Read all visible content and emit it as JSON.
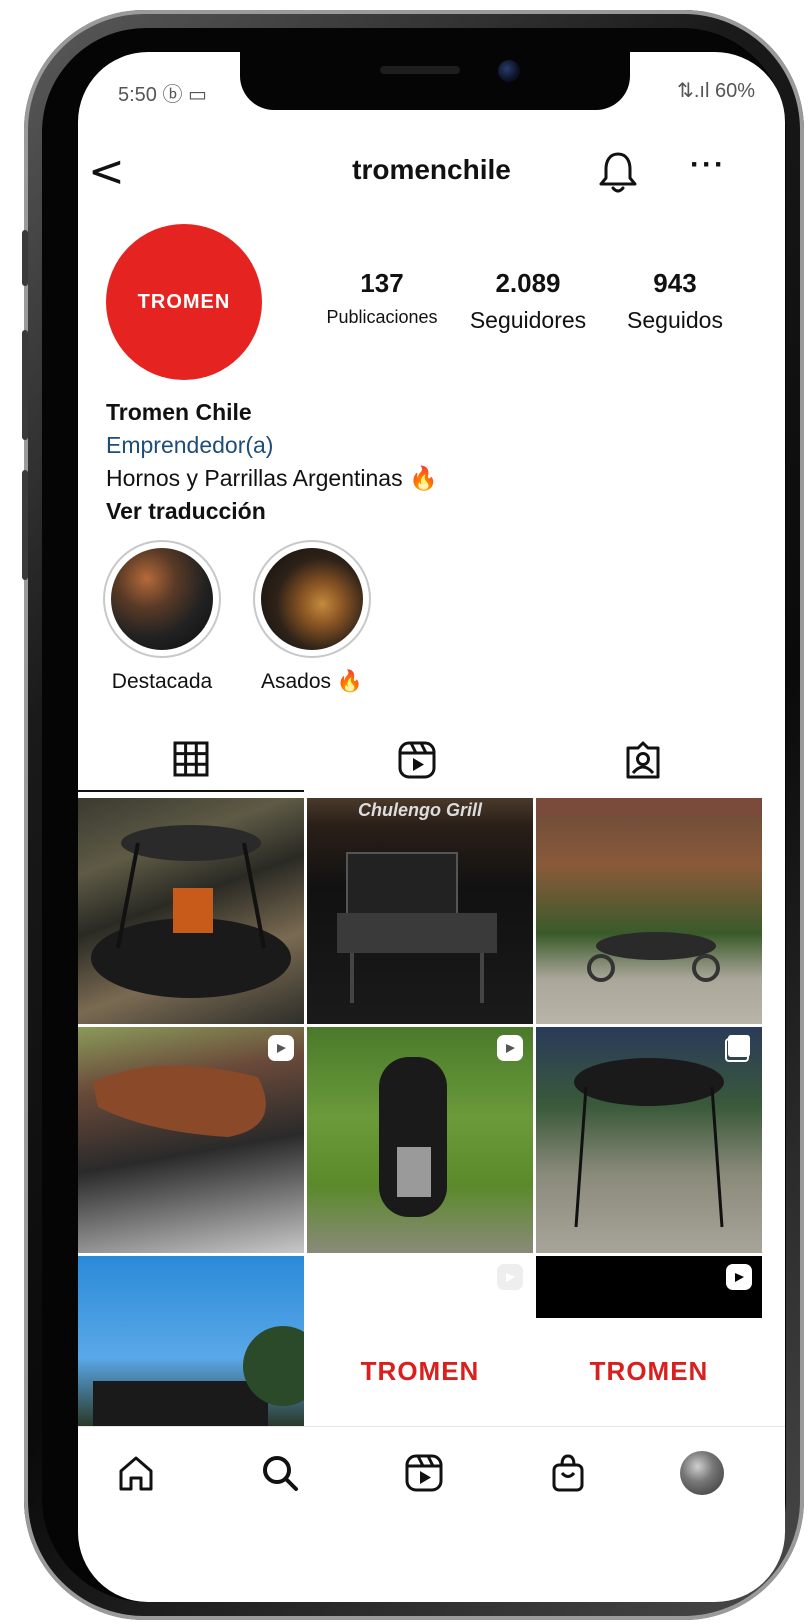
{
  "status_bar": {
    "time": "5:50",
    "left_icons": "ⓑ ▭",
    "right": "⇅.ıl 60%"
  },
  "header": {
    "username": "tromenchile"
  },
  "profile": {
    "avatar_text": "TROMEN",
    "stats": [
      {
        "value": "137",
        "label": "Publicaciones"
      },
      {
        "value": "2.089",
        "label": "Seguidores"
      },
      {
        "value": "943",
        "label": "Seguidos"
      }
    ],
    "name": "Tromen Chile",
    "category": "Emprendedor(a)",
    "bio": "Hornos y Parrillas Argentinas 🔥",
    "translate": "Ver traducción"
  },
  "highlights": [
    {
      "label": "Destacada"
    },
    {
      "label": "Asados 🔥"
    }
  ],
  "grid": {
    "c2_label": "Chulengo Grill",
    "c8_brand": "TROMEN",
    "c9_brand": "TROMEN"
  },
  "colors": {
    "brand_red": "#e52421",
    "link_blue": "#1e4d7a"
  }
}
